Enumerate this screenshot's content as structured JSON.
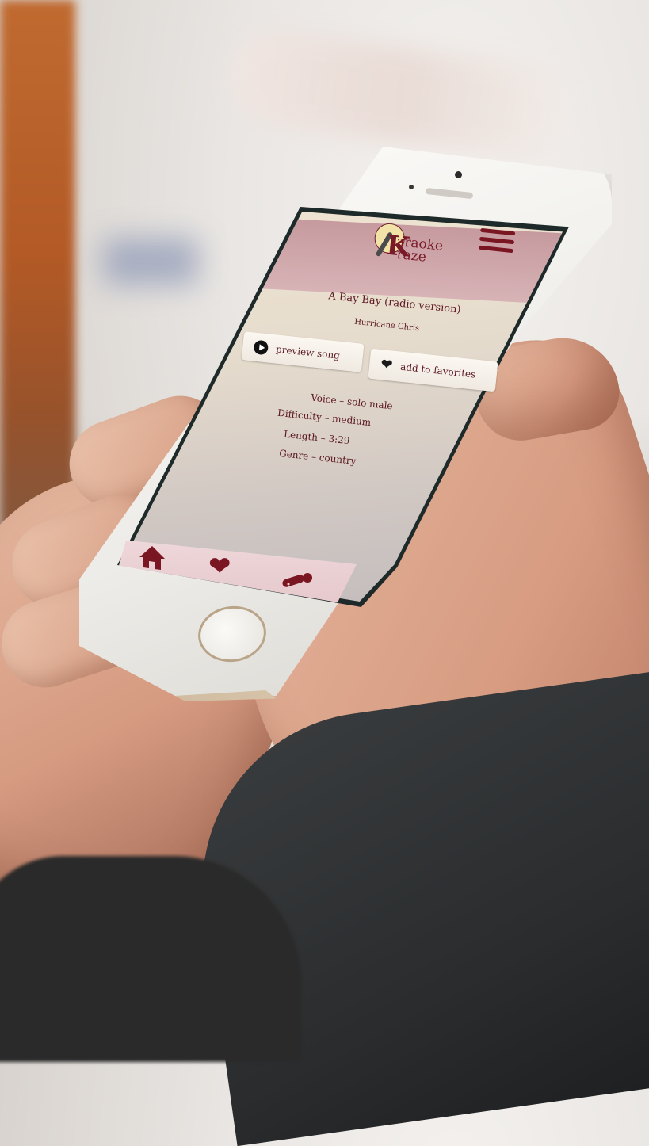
{
  "app": {
    "logo_line1": "araoke",
    "logo_line2": "raze",
    "logo_initial": "K"
  },
  "song": {
    "title": "A Bay Bay (radio version)",
    "artist": "Hurricane Chris"
  },
  "actions": {
    "preview_label": "preview song",
    "favorite_label": "add to favorites"
  },
  "details": {
    "voice": "Voice – solo male",
    "difficulty": "Difficulty – medium",
    "length": "Length – 3:29",
    "genre": "Genre – country"
  },
  "icons": {
    "menu": "hamburger-menu-icon",
    "home": "home-icon",
    "favorites": "heart-icon",
    "mic": "microphone-icon",
    "play": "play-icon"
  },
  "colors": {
    "brand": "#7a1522",
    "header": "#c69a9f",
    "text": "#5b1621"
  }
}
